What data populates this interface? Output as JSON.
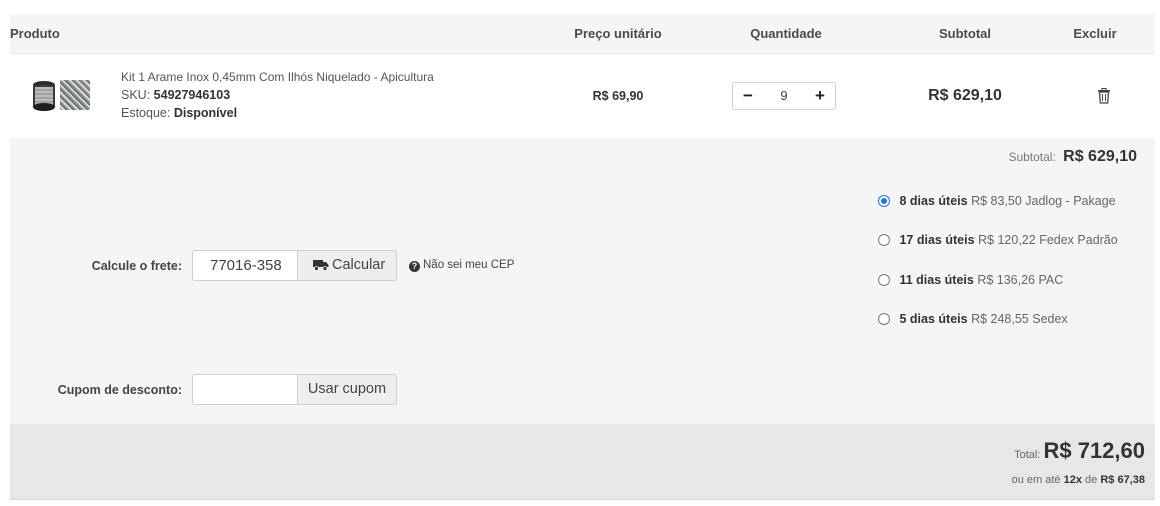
{
  "header": {
    "produto": "Produto",
    "preco_unitario": "Preço unitário",
    "quantidade": "Quantidade",
    "subtotal": "Subtotal",
    "excluir": "Excluir"
  },
  "item": {
    "name": "Kit 1 Arame Inox 0,45mm Com Ilhós Niquelado - Apicultura",
    "sku_label": "SKU:",
    "sku": "54927946103",
    "stock_label": "Estoque:",
    "stock": "Disponível",
    "unit_price": "R$ 69,90",
    "quantity": "9",
    "minus_label": "−",
    "plus_label": "+",
    "subtotal": "R$ 629,10",
    "delete_icon": "trash-icon"
  },
  "summary": {
    "subtotal_label": "Subtotal:",
    "subtotal_value": "R$ 629,10"
  },
  "shipping": {
    "label": "Calcule o frete:",
    "cep": "77016-358",
    "button_label": "Calcular",
    "help_link": "Não sei meu CEP",
    "options": [
      {
        "days": "8 dias úteis",
        "price": "R$ 83,50",
        "carrier": "Jadlog - Pakage",
        "selected": true
      },
      {
        "days": "17 dias úteis",
        "price": "R$ 120,22",
        "carrier": "Fedex Padrão",
        "selected": false
      },
      {
        "days": "11 dias úteis",
        "price": "R$ 136,26",
        "carrier": "PAC",
        "selected": false
      },
      {
        "days": "5 dias úteis",
        "price": "R$ 248,55",
        "carrier": "Sedex",
        "selected": false
      }
    ]
  },
  "coupon": {
    "label": "Cupom de desconto:",
    "value": "",
    "button_label": "Usar cupom"
  },
  "total": {
    "label": "Total:",
    "value": "R$ 712,60",
    "installment_prefix": "ou em até",
    "installment_count": "12x",
    "installment_mid": "de",
    "installment_value": "R$ 67,38"
  },
  "colors": {
    "accent": "#1a73e8",
    "panel_bg": "#f4f5f6",
    "total_bg": "#e6e7e8"
  }
}
